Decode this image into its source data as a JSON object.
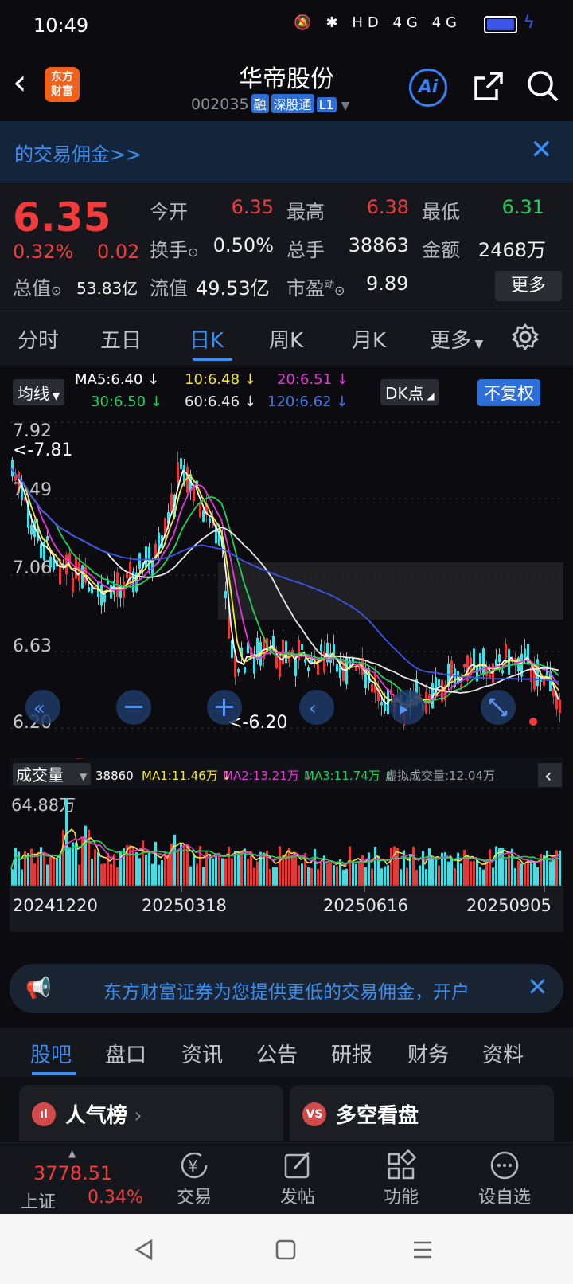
{
  "status_bar": {
    "time": "10:49",
    "icons": "🔕 ✱ HD 4G 4G"
  },
  "header": {
    "logo_line1": "东方",
    "logo_line2": "财富",
    "stock_name": "华帝股份",
    "stock_code": "002035",
    "tags": [
      "融",
      "深股通",
      "L1"
    ]
  },
  "banner": {
    "text": "的交易佣金>>"
  },
  "quote": {
    "price": "6.35",
    "change_pct": "0.32%",
    "change": "0.02",
    "rows": [
      [
        {
          "label": "今开",
          "value": "6.35",
          "color": "red"
        },
        {
          "label": "最高",
          "value": "6.38",
          "color": "red"
        },
        {
          "label": "最低",
          "value": "6.31",
          "color": "green"
        }
      ],
      [
        {
          "label": "换手",
          "value": "0.50%",
          "color": "white"
        },
        {
          "label": "总手",
          "value": "38863",
          "color": "white"
        },
        {
          "label": "金额",
          "value": "2468万",
          "color": "white"
        }
      ]
    ],
    "total_value_label": "总值",
    "total_value": "53.83亿",
    "float_value_label": "流值",
    "float_value": "49.53亿",
    "pe_label": "市盈",
    "pe_sup": "动",
    "pe_value": "9.89",
    "more": "更多"
  },
  "period_tabs": [
    "分时",
    "五日",
    "日K",
    "周K",
    "月K",
    "更多"
  ],
  "active_period": "日K",
  "ma_row": {
    "selector": "均线",
    "ma5": "MA5:6.40 ↓",
    "ma10": "10:6.48 ↓",
    "ma20": "20:6.51 ↓",
    "ma30": "30:6.50 ↓",
    "ma60": "60:6.46 ↓",
    "ma120": "120:6.62 ↓",
    "dk": "DK点",
    "adjust": "不复权"
  },
  "chart_data": [
    {
      "type": "candlestick",
      "y_ticks": [
        "7.92",
        "7.49",
        "7.06",
        "6.63",
        "6.20"
      ],
      "ylim": [
        6.2,
        7.92
      ],
      "high_marker": "<-7.81",
      "low_marker": "<-6.20",
      "colors": {
        "up": "#e23a3a",
        "down": "#3de0e6",
        "ma5": "#ffffff",
        "ma10": "#f5e83a",
        "ma20": "#e23ad6",
        "ma30": "#1fd05a",
        "ma60": "#e8e8e8",
        "ma120": "#3a55e8"
      }
    },
    {
      "type": "bar",
      "title": "成交量",
      "y_max_label": "64.88万",
      "legend": [
        "38860",
        "MA1:11.46万 ↓",
        "MA2:13.21万 ↓",
        "MA3:11.74万 ↓",
        "虚拟成交量:12.04万"
      ],
      "x_tick_labels": [
        "20241220",
        "20250318",
        "20250616",
        "20250905"
      ]
    }
  ],
  "promo": {
    "text": "东方财富证券为您提供更低的交易佣金，开户"
  },
  "section_tabs": [
    "股吧",
    "盘口",
    "资讯",
    "公告",
    "研报",
    "财务",
    "资料"
  ],
  "cards": [
    {
      "icon": "ıl",
      "title": "人气榜"
    },
    {
      "icon": "VS",
      "title": "多空看盘"
    }
  ],
  "bottom_nav": {
    "index_value": "3778.51",
    "index_name": "上证",
    "index_pct": "0.34%",
    "items": [
      "交易",
      "发帖",
      "功能",
      "设自选"
    ]
  }
}
